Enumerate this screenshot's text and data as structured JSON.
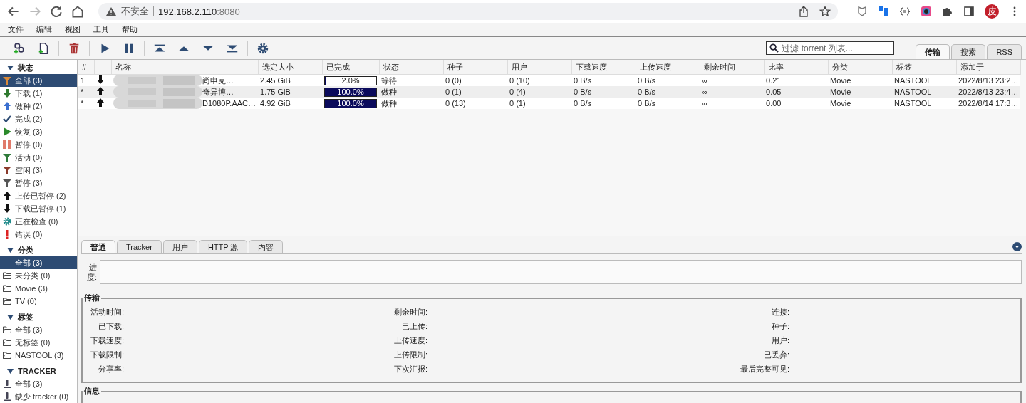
{
  "browser": {
    "security_label": "不安全",
    "url_host": "192.168.2.110",
    "url_port": ":8080",
    "profile_initial": "皮"
  },
  "menu": [
    "文件",
    "编辑",
    "视图",
    "工具",
    "帮助"
  ],
  "search": {
    "placeholder": "过滤 torrent 列表..."
  },
  "top_tabs": [
    {
      "label": "传输",
      "selected": true
    },
    {
      "label": "搜索",
      "selected": false
    },
    {
      "label": "RSS",
      "selected": false
    }
  ],
  "sidebar": [
    {
      "title": "状态",
      "expanded": true,
      "items": [
        {
          "label": "全部 (3)",
          "kind": "all",
          "selected": true
        },
        {
          "label": "下载 (1)",
          "kind": "downloading",
          "selected": false
        },
        {
          "label": "做种 (2)",
          "kind": "seeding",
          "selected": false
        },
        {
          "label": "完成 (2)",
          "kind": "completed",
          "selected": false
        },
        {
          "label": "恢复 (3)",
          "kind": "resumed",
          "selected": false
        },
        {
          "label": "暂停 (0)",
          "kind": "paused",
          "selected": false
        },
        {
          "label": "活动 (0)",
          "kind": "active",
          "selected": false
        },
        {
          "label": "空闲 (3)",
          "kind": "inactive",
          "selected": false
        },
        {
          "label": "暂停 (3)",
          "kind": "stalled",
          "selected": false
        },
        {
          "label": "上传已暂停 (2)",
          "kind": "up_paused",
          "selected": false
        },
        {
          "label": "下载已暂停 (1)",
          "kind": "down_paused",
          "selected": false
        },
        {
          "label": "正在检查 (0)",
          "kind": "checking",
          "selected": false
        },
        {
          "label": "错误 (0)",
          "kind": "error",
          "selected": false
        }
      ]
    },
    {
      "title": "分类",
      "expanded": true,
      "items": [
        {
          "label": "全部 (3)",
          "kind": "none",
          "selected": true
        },
        {
          "label": "未分类 (0)",
          "kind": "folder",
          "selected": false
        },
        {
          "label": "Movie (3)",
          "kind": "folder",
          "selected": false
        },
        {
          "label": "TV (0)",
          "kind": "folder",
          "selected": false
        }
      ]
    },
    {
      "title": "标签",
      "expanded": true,
      "items": [
        {
          "label": "全部 (3)",
          "kind": "folder",
          "selected": false
        },
        {
          "label": "无标签 (0)",
          "kind": "folder",
          "selected": false
        },
        {
          "label": "NASTOOL (3)",
          "kind": "folder",
          "selected": false
        }
      ]
    },
    {
      "title": "TRACKER",
      "expanded": true,
      "items": [
        {
          "label": "全部 (3)",
          "kind": "tracker",
          "selected": false
        },
        {
          "label": "缺少 tracker (0)",
          "kind": "tracker",
          "selected": false
        }
      ]
    }
  ],
  "table": {
    "columns": [
      "#",
      "名称",
      "选定大小",
      "已完成",
      "状态",
      "种子",
      "用户",
      "下载速度",
      "上传速度",
      "剩余时间",
      "比率",
      "分类",
      "标签",
      "添加于"
    ],
    "rows": [
      {
        "index": "1",
        "kind": "down",
        "name": "尚申克…",
        "size": "2.45 GiB",
        "level": 0.02,
        "progress": "2.0%",
        "status": "等待",
        "seeds": "0 (0)",
        "peers": "0 (10)",
        "down_speed": "0 B/s",
        "up_speed": "0 B/s",
        "eta": "∞",
        "ratio": "0.21",
        "category": "Movie",
        "tags": "NASTOOL",
        "added": "2022/8/13 23:2…"
      },
      {
        "index": "*",
        "kind": "up",
        "name": "奇异博…",
        "size": "1.75 GiB",
        "level": 1,
        "progress": "100.0%",
        "status": "做种",
        "seeds": "0 (1)",
        "peers": "0 (4)",
        "down_speed": "0 B/s",
        "up_speed": "0 B/s",
        "eta": "∞",
        "ratio": "0.05",
        "category": "Movie",
        "tags": "NASTOOL",
        "added": "2022/8/13 23:4…"
      },
      {
        "index": "*",
        "kind": "up",
        "name": "D1080P.AAC…",
        "size": "4.92 GiB",
        "level": 1,
        "progress": "100.0%",
        "status": "做种",
        "seeds": "0 (13)",
        "peers": "0 (1)",
        "down_speed": "0 B/s",
        "up_speed": "0 B/s",
        "eta": "∞",
        "ratio": "0.00",
        "category": "Movie",
        "tags": "NASTOOL",
        "added": "2022/8/14 17:3…"
      }
    ]
  },
  "detail_tabs": [
    {
      "label": "普通",
      "selected": true
    },
    {
      "label": "Tracker",
      "selected": false
    },
    {
      "label": "用户",
      "selected": false
    },
    {
      "label": "HTTP 源",
      "selected": false
    },
    {
      "label": "内容",
      "selected": false
    }
  ],
  "progress_label": "进度:",
  "transfer": {
    "title": "传输",
    "columns": [
      [
        "活动时间:",
        "已下载:",
        "下载速度:",
        "下载限制:",
        "分享率:"
      ],
      [
        "剩余时间:",
        "已上传:",
        "上传速度:",
        "上传限制:",
        "下次汇报:"
      ],
      [
        "连接:",
        "种子:",
        "用户:",
        "已丢弃:",
        "最后完整可见:"
      ]
    ]
  },
  "info": {
    "title": "信息"
  }
}
